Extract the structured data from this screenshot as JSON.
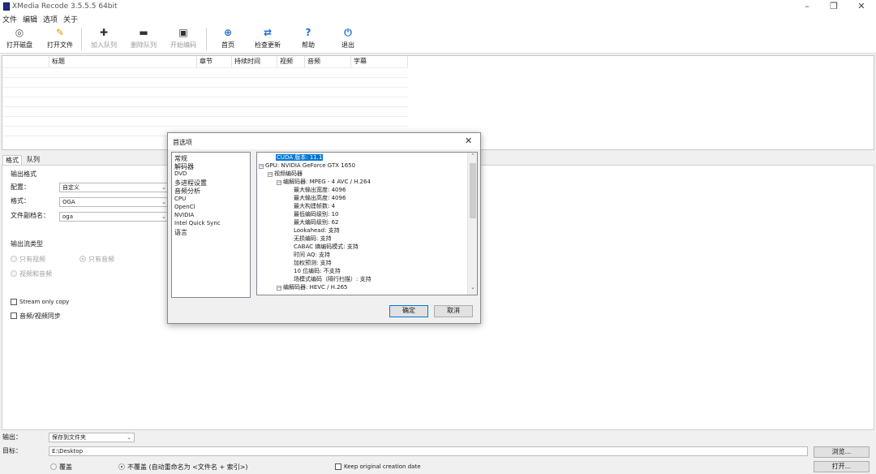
{
  "window": {
    "title": "XMedia Recode 3.5.5.5 64bit",
    "controls": {
      "minimize": "–",
      "maximize": "❐",
      "close": "✕"
    }
  },
  "menu": [
    "文件",
    "编辑",
    "选项",
    "关于"
  ],
  "toolbar": [
    {
      "label": "打开磁盘",
      "icon": "disc-icon",
      "enabled": true
    },
    {
      "label": "打开文件",
      "icon": "open-file-icon",
      "enabled": true
    },
    {
      "label": "加入队列",
      "icon": "plus-icon",
      "enabled": false
    },
    {
      "label": "删除队列",
      "icon": "minus-icon",
      "enabled": false
    },
    {
      "label": "开始编码",
      "icon": "encode-icon",
      "enabled": false
    },
    {
      "label": "首页",
      "icon": "globe-icon",
      "enabled": true
    },
    {
      "label": "检查更新",
      "icon": "refresh-icon",
      "enabled": true
    },
    {
      "label": "帮助",
      "icon": "help-icon",
      "enabled": true
    },
    {
      "label": "退出",
      "icon": "power-icon",
      "enabled": true
    }
  ],
  "file_list": {
    "columns": [
      "标题",
      "章节",
      "持续时间",
      "视频",
      "音频",
      "字幕"
    ]
  },
  "tabs": [
    "格式",
    "队列"
  ],
  "format_panel": {
    "output_format_section": "输出格式",
    "profile_label": "配置：",
    "profile_value": "自定义",
    "format_label": "格式：",
    "format_value": "OGA",
    "extension_label": "文件副档名：",
    "extension_value": "oga",
    "stream_type_section": "输出流类型",
    "stream_options": [
      {
        "label": "只有视频",
        "selected": false
      },
      {
        "label": "只有音频",
        "selected": true
      },
      {
        "label": "视频和音频",
        "selected": false
      }
    ],
    "stream_only_copy": "Stream only copy",
    "av_sync": "音频/视频同步"
  },
  "bottom": {
    "output_label": "输出：",
    "output_value": "保存到文件夹",
    "target_label": "目标：",
    "target_path": "E:\\Desktop",
    "browse": "浏览...",
    "open": "打开...",
    "overwrite": "覆盖",
    "no_overwrite": "不覆盖 (自动重命名为 <文件名 + 索引>)",
    "keep_date": "Keep original creation date"
  },
  "dialog": {
    "title": "首选项",
    "close": "✕",
    "nav": [
      "常规",
      "解码器",
      "DVD",
      "多进程设置",
      "音频分析",
      "CPU",
      "OpenCl",
      "NVIDIA",
      "Intel Quick Sync",
      "语言"
    ],
    "tree": [
      {
        "text": "CUDA 版本: 11.1",
        "depth": 1,
        "selected": true,
        "expander": ""
      },
      {
        "text": "GPU: NVIDIA GeForce GTX 1650",
        "depth": 0,
        "expander": "−"
      },
      {
        "text": "视频编码器",
        "depth": 1,
        "expander": "−"
      },
      {
        "text": "编解码器: MPEG - 4 AVC / H.264",
        "depth": 2,
        "expander": "−"
      },
      {
        "text": "最大输出宽度: 4096",
        "depth": 3,
        "expander": ""
      },
      {
        "text": "最大输出高度: 4096",
        "depth": 3,
        "expander": ""
      },
      {
        "text": "最大构建帧数: 4",
        "depth": 3,
        "expander": ""
      },
      {
        "text": "最低编码级别: 10",
        "depth": 3,
        "expander": ""
      },
      {
        "text": "最大编码级别: 62",
        "depth": 3,
        "expander": ""
      },
      {
        "text": "Lookahead: 支持",
        "depth": 3,
        "expander": ""
      },
      {
        "text": "无损编码: 支持",
        "depth": 3,
        "expander": ""
      },
      {
        "text": "CABAC 熵编码模式: 支持",
        "depth": 3,
        "expander": ""
      },
      {
        "text": "时间 AQ: 支持",
        "depth": 3,
        "expander": ""
      },
      {
        "text": "加权预测: 支持",
        "depth": 3,
        "expander": ""
      },
      {
        "text": "10 位编码: 不支持",
        "depth": 3,
        "expander": ""
      },
      {
        "text": "场模式编码（隔行扫描）: 支持",
        "depth": 3,
        "expander": ""
      },
      {
        "text": "编解码器: HEVC / H.265",
        "depth": 2,
        "expander": "−"
      }
    ],
    "ok": "确定",
    "cancel": "取消"
  },
  "colors": {
    "accent": "#0078d7",
    "app_icon": "#1f2e7a"
  }
}
